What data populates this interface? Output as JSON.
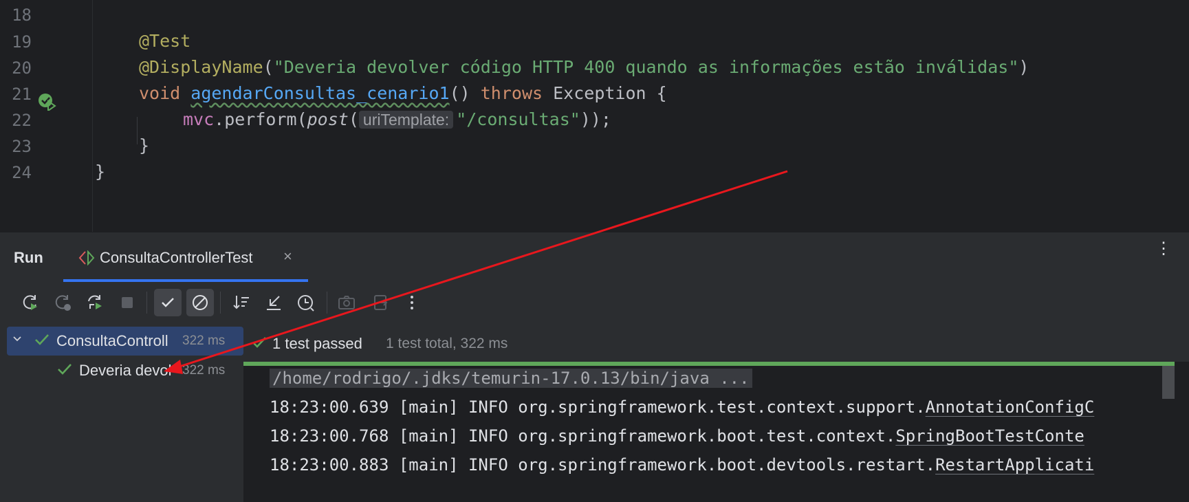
{
  "editor": {
    "lines": [
      {
        "num": "18"
      },
      {
        "num": "19",
        "annotation": "@Test"
      },
      {
        "num": "20",
        "annotation": "@DisplayName",
        "open": "(",
        "string": "\"Deveria devolver código HTTP 400 quando as informações estão inválidas\"",
        "close": ")"
      },
      {
        "num": "21",
        "kw_void": "void",
        "method": "agendarConsultas_cenario1",
        "parens": "()",
        "kw_throws": "throws",
        "rest": "Exception {"
      },
      {
        "num": "22",
        "field": "mvc",
        "call": ".perform(",
        "post": "post",
        "popen": "(",
        "hint": "uriTemplate:",
        "string": "\"/consultas\"",
        "end": "));"
      },
      {
        "num": "23",
        "brace": "}"
      },
      {
        "num": "24",
        "brace": "}"
      }
    ]
  },
  "run_panel": {
    "title": "Run",
    "tab_label": "ConsultaControllerTest",
    "tab_close": "×",
    "more": "⋮"
  },
  "tree": {
    "root_label": "ConsultaControll",
    "root_time": "322 ms",
    "child_label": "Deveria devol",
    "child_time": "322 ms"
  },
  "results": {
    "status": "1 test passed",
    "summary": "1 test total, 322 ms"
  },
  "console": {
    "cmd": "/home/rodrigo/.jdks/temurin-17.0.13/bin/java ...",
    "logs": [
      {
        "prefix": "18:23:00.639 [main] INFO org.springframework.test.context.support.",
        "cls": "AnnotationConfigC"
      },
      {
        "prefix": "18:23:00.768 [main] INFO org.springframework.boot.test.context.",
        "cls": "SpringBootTestConte"
      },
      {
        "prefix": "18:23:00.883 [main] INFO org.springframework.boot.devtools.restart.",
        "cls": "RestartApplicati"
      }
    ]
  },
  "colors": {
    "pass": "#5fa75a",
    "accent": "#3574f0",
    "annotation_arrow": "#e8171d"
  }
}
